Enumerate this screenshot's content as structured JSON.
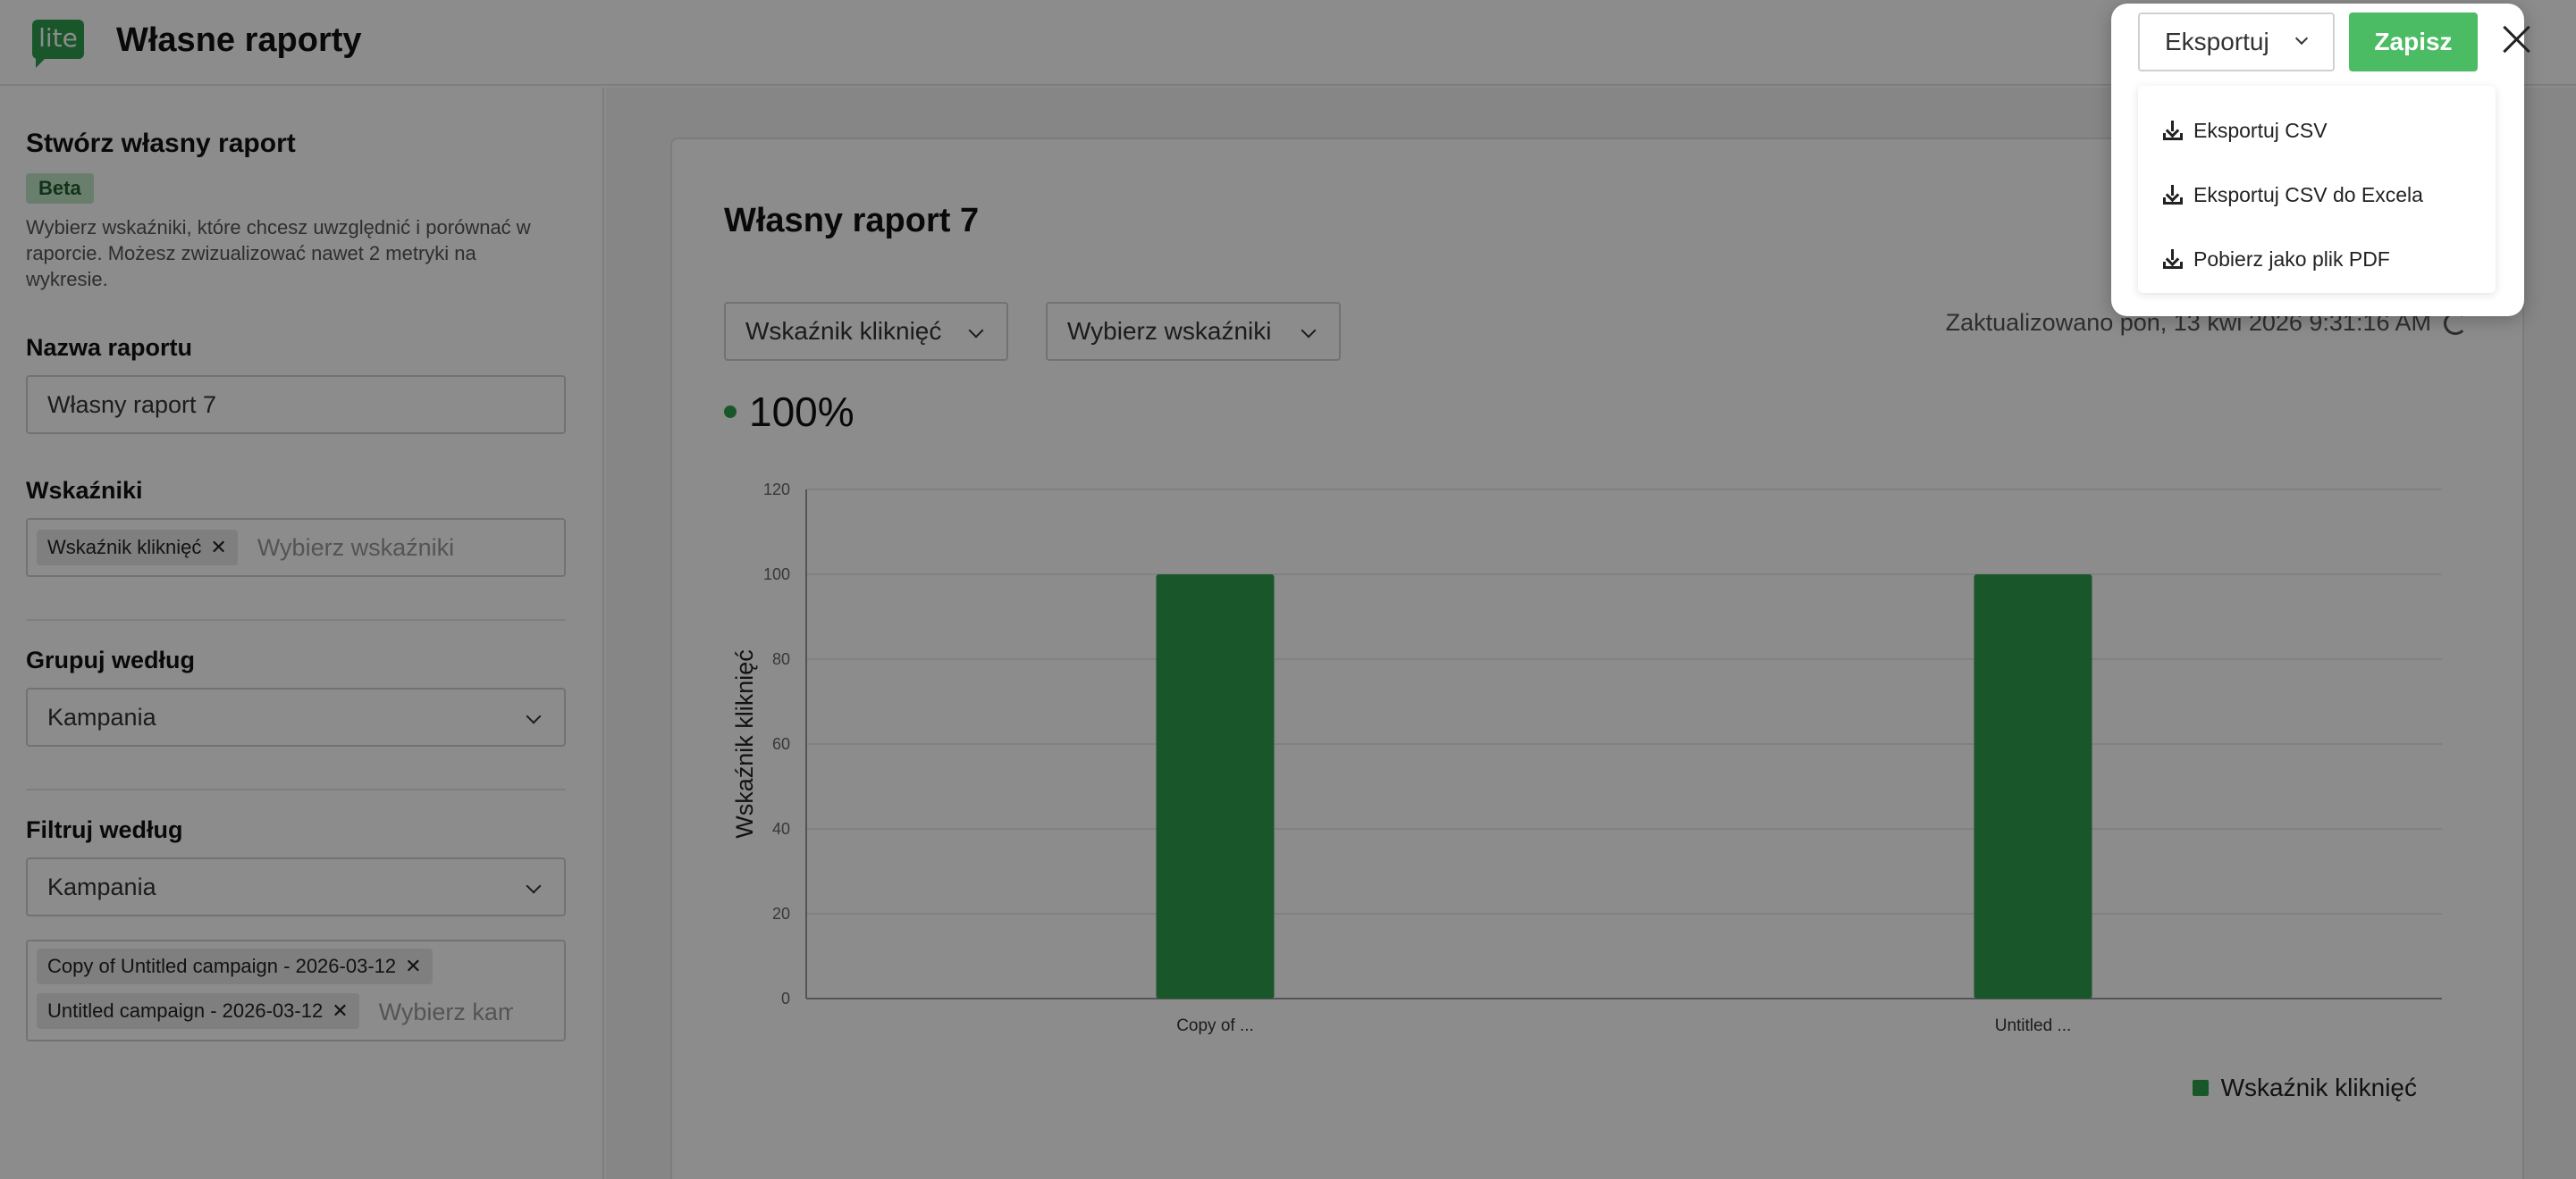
{
  "header": {
    "logo_text": "lite",
    "title": "Własne raporty"
  },
  "actions": {
    "export_label": "Eksportuj",
    "save_label": "Zapisz",
    "export_menu": [
      "Eksportuj CSV",
      "Eksportuj CSV do Excela",
      "Pobierz jako plik PDF"
    ]
  },
  "sidebar": {
    "title": "Stwórz własny raport",
    "badge": "Beta",
    "description": "Wybierz wskaźniki, które chcesz uwzględnić i porównać w raporcie. Możesz zwizualizować nawet 2 metryki na wykresie.",
    "report_name": {
      "label": "Nazwa raportu",
      "value": "Własny raport 7"
    },
    "metrics": {
      "label": "Wskaźniki",
      "tags": [
        "Wskaźnik kliknięć"
      ],
      "placeholder": "Wybierz wskaźniki"
    },
    "group_by": {
      "label": "Grupuj według",
      "value": "Kampania"
    },
    "filter_by": {
      "label": "Filtruj według",
      "value": "Kampania",
      "tags": [
        "Copy of Untitled campaign - 2026-03-12",
        "Untitled campaign - 2026-03-12"
      ],
      "placeholder": "Wybierz kampanie"
    }
  },
  "main": {
    "report_title": "Własny raport 7",
    "metric_select_1": "Wskaźnik kliknięć",
    "metric_select_2": "Wybierz wskaźniki",
    "updated": "Zaktualizowano pon, 13 kwi 2026 9:31:16 AM",
    "big_value": "100%"
  },
  "chart_data": {
    "type": "bar",
    "categories": [
      "Copy of ...",
      "Untitled ..."
    ],
    "series": [
      {
        "name": "Wskaźnik kliknięć",
        "values": [
          100,
          100
        ],
        "color": "#2f9e4f"
      }
    ],
    "ylabel": "Wskaźnik kliknięć",
    "ylim": [
      0,
      120
    ],
    "yticks": [
      0,
      20,
      40,
      60,
      80,
      100,
      120
    ],
    "grid": true,
    "legend": "bottom-right"
  }
}
